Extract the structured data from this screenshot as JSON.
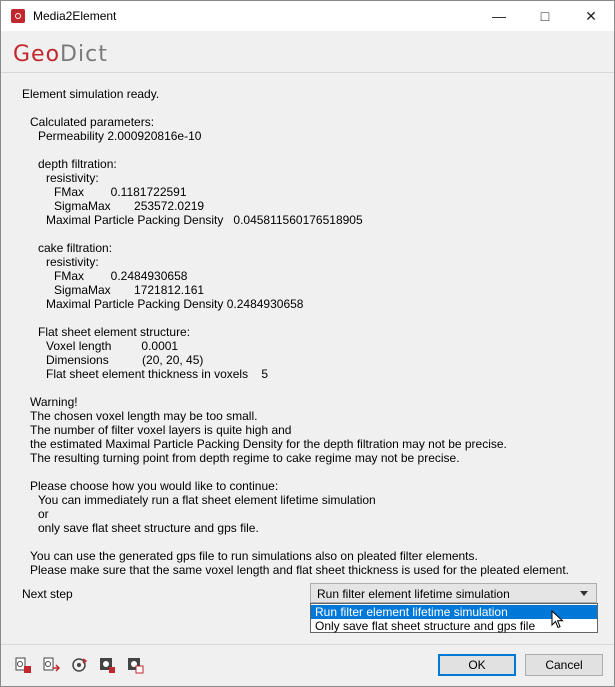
{
  "window": {
    "title": "Media2Element"
  },
  "logo": {
    "part1": "Geo",
    "part2": "Dict"
  },
  "lines": [
    "Element simulation ready.",
    "Calculated parameters:",
    "Permeability 2.000920816e-10",
    "depth filtration:",
    "resistivity:",
    "FMax        0.1181722591",
    "SigmaMax       253572.0219",
    "Maximal Particle Packing Density   0.045811560176518905",
    "cake filtration:",
    "resistivity:",
    "FMax        0.2484930658",
    "SigmaMax       1721812.161",
    "Maximal Particle Packing Density 0.2484930658",
    "Flat sheet element structure:",
    "Voxel length         0.0001",
    "Dimensions          (20, 20, 45)",
    "Flat sheet element thickness in voxels    5",
    "Warning!",
    "The chosen voxel length may be too small.",
    "The number of filter voxel layers is quite high and",
    "the estimated Maximal Particle Packing Density for the depth filtration may not be precise.",
    "The resulting turning point from depth regime to cake regime may not be precise.",
    "Please choose how you would like to continue:",
    "You can immediately run a flat sheet element lifetime simulation",
    "or",
    "only save flat sheet structure and gps file.",
    "You can use the generated gps file to run simulations also on pleated filter elements.",
    "Please make sure that the same voxel length and flat sheet thickness is used for the pleated element."
  ],
  "next_step": {
    "label": "Next step",
    "selected": "Run filter element lifetime simulation",
    "options": [
      "Run filter element lifetime simulation",
      "Only save flat sheet structure and gps file"
    ]
  },
  "buttons": {
    "ok": "OK",
    "cancel": "Cancel"
  },
  "colors": {
    "accent": "#0078d7",
    "brand": "#c1272d"
  }
}
